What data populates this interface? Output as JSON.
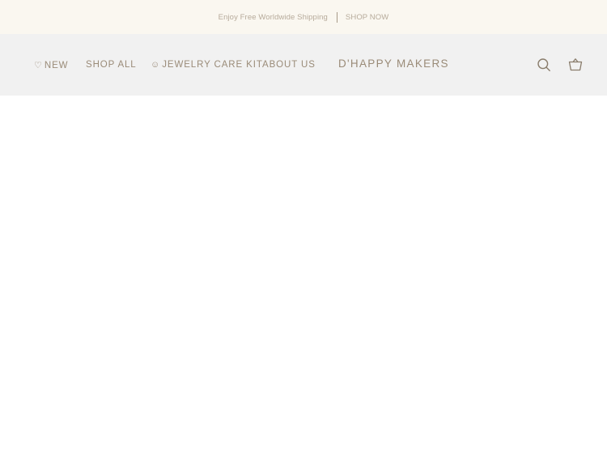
{
  "announcement": {
    "text": "Enjoy Free Worldwide Shipping",
    "link_label": "SHOP NOW"
  },
  "nav": {
    "items": [
      {
        "icon": "heart-icon",
        "icon_glyph": "♡",
        "label": "NEW"
      },
      {
        "label": "SHOP ALL"
      },
      {
        "icon": "smiley-icon",
        "icon_glyph": "☺",
        "label": "JEWELRY CARE KIT"
      },
      {
        "label": "ABOUT US"
      }
    ],
    "brand": "D'HAPPY MAKERS",
    "icons": [
      "search-icon",
      "cart-icon"
    ]
  },
  "colors": {
    "announcement_bg": "#faf7f0",
    "header_bg": "#f1f1f1",
    "nav_text": "#9a8b78",
    "announcement_text": "#b7ab9b"
  }
}
